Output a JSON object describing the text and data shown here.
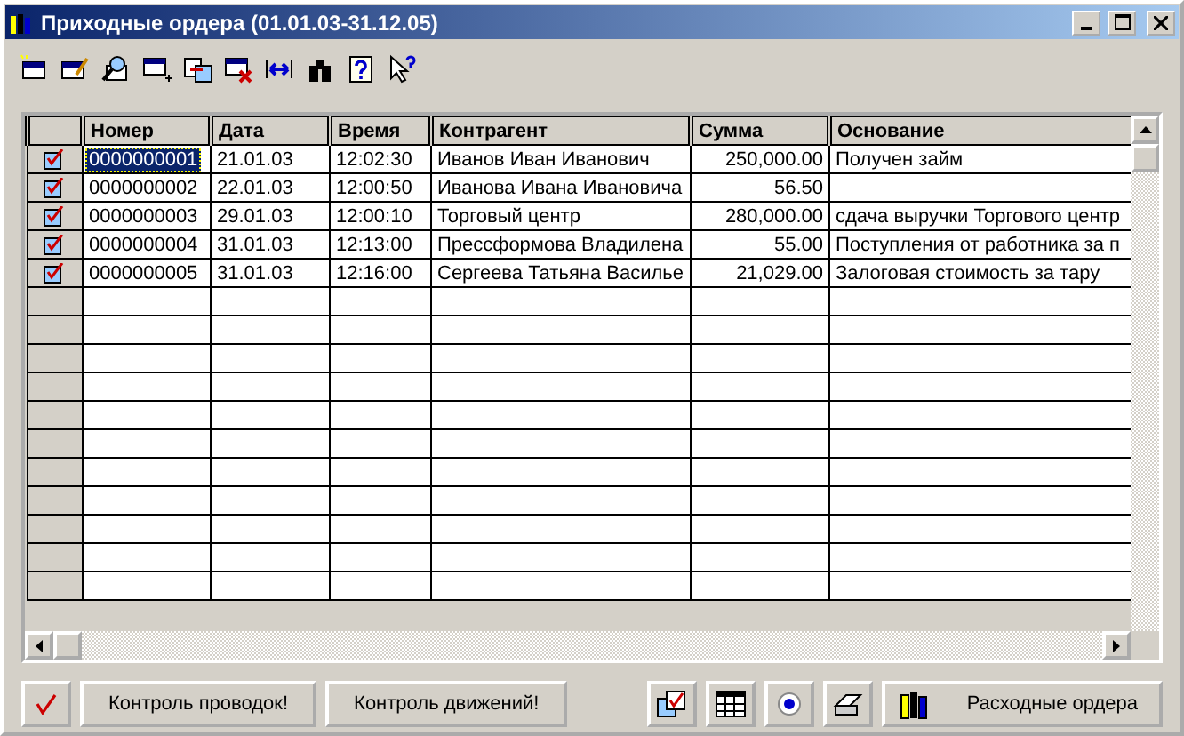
{
  "window": {
    "title": "Приходные ордера (01.01.03-31.12.05)"
  },
  "table": {
    "columns": [
      "Номер",
      "Дата",
      "Время",
      "Контрагент",
      "Сумма",
      "Основание"
    ],
    "rows": [
      {
        "selected": true,
        "cells": [
          "0000000001",
          "21.01.03",
          "12:02:30",
          "Иванов Иван Иванович",
          "250,000.00",
          "Получен займ"
        ]
      },
      {
        "selected": false,
        "cells": [
          "0000000002",
          "22.01.03",
          "12:00:50",
          "Иванова Ивана Ивановича",
          "56.50",
          ""
        ]
      },
      {
        "selected": false,
        "cells": [
          "0000000003",
          "29.01.03",
          "12:00:10",
          "Торговый центр",
          "280,000.00",
          "сдача выручки Торгового центр"
        ]
      },
      {
        "selected": false,
        "cells": [
          "0000000004",
          "31.01.03",
          "12:13:00",
          "Прессформова Владилена",
          "55.00",
          "Поступления от работника за п"
        ]
      },
      {
        "selected": false,
        "cells": [
          "0000000005",
          "31.01.03",
          "12:16:00",
          "Сергеева Татьяна Василье",
          "21,029.00",
          "Залоговая стоимость за тару"
        ]
      }
    ]
  },
  "buttons": [
    "Контроль проводок!",
    "Контроль движений!"
  ],
  "open_button": "Расходные ордера"
}
